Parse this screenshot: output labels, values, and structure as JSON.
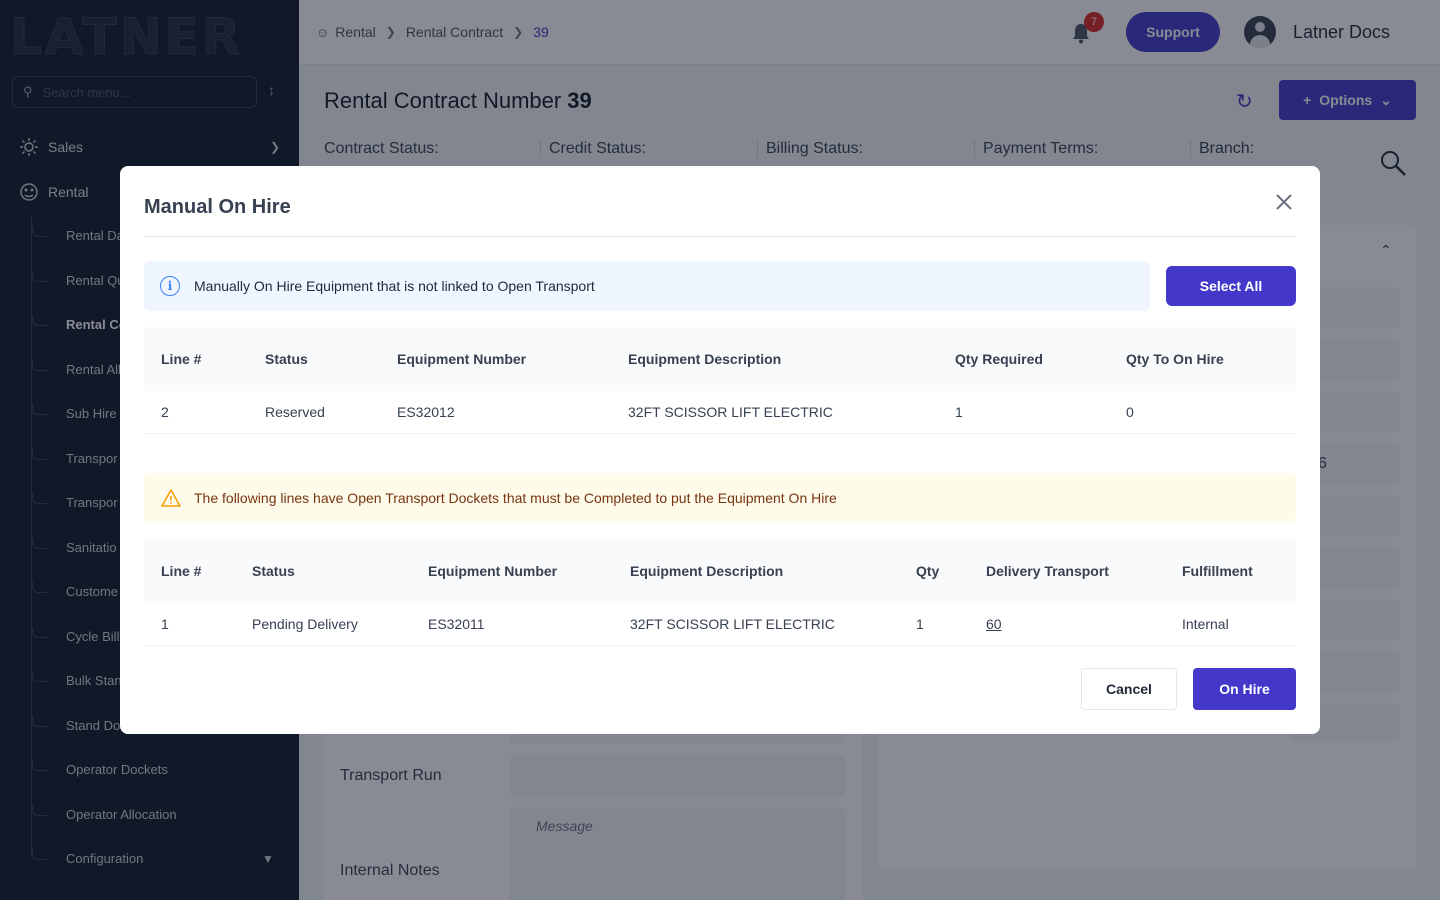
{
  "sidebar": {
    "logo": "LATNER",
    "search_placeholder": "Search menu...",
    "top_items": [
      {
        "label": "Sales",
        "icon": "sales-icon"
      },
      {
        "label": "Rental",
        "icon": "rental-icon"
      }
    ],
    "rental_sub_items": [
      "Rental Da",
      "Rental Qu",
      "Rental Co",
      "Rental All",
      "Sub Hire",
      "Transpor",
      "Transpor",
      "Sanitatio",
      "Custome",
      "Cycle Bill",
      "Bulk Stan",
      "Stand Do",
      "Operator Dockets",
      "Operator Allocation",
      "Configuration"
    ]
  },
  "header": {
    "breadcrumb": [
      "Rental",
      "Rental Contract",
      "39"
    ],
    "notification_count": "7",
    "support_label": "Support",
    "user_name": "Latner Docs"
  },
  "page": {
    "title": "Rental Contract Number",
    "contract_number": "39",
    "options_label": "Options",
    "status_labels": [
      "Contract Status:",
      "Credit Status:",
      "Billing Status:",
      "Payment Terms:",
      "Branch:"
    ],
    "field_labels": [
      "Transport Run",
      "Internal Notes"
    ],
    "message_placeholder": "Message",
    "partial_value": "6"
  },
  "modal": {
    "title": "Manual On Hire",
    "info_text": "Manually On Hire Equipment that is not linked to Open Transport",
    "select_all_label": "Select All",
    "table1": {
      "headers": [
        "Line #",
        "Status",
        "Equipment Number",
        "Equipment Description",
        "Qty Required",
        "Qty To On Hire"
      ],
      "rows": [
        {
          "line": "2",
          "status": "Reserved",
          "equipment_number": "ES32012",
          "description": "32FT SCISSOR LIFT ELECTRIC",
          "qty_required": "1",
          "qty_to_on_hire": "0"
        }
      ]
    },
    "warning_text": "The following lines have Open Transport Dockets that must be Completed to put the Equipment On Hire",
    "table2": {
      "headers": [
        "Line #",
        "Status",
        "Equipment Number",
        "Equipment Description",
        "Qty",
        "Delivery Transport",
        "Fulfillment"
      ],
      "rows": [
        {
          "line": "1",
          "status": "Pending Delivery",
          "equipment_number": "ES32011",
          "description": "32FT SCISSOR LIFT ELECTRIC",
          "qty": "1",
          "delivery_transport": "60",
          "fulfillment": "Internal"
        }
      ]
    },
    "cancel_label": "Cancel",
    "on_hire_label": "On Hire"
  }
}
